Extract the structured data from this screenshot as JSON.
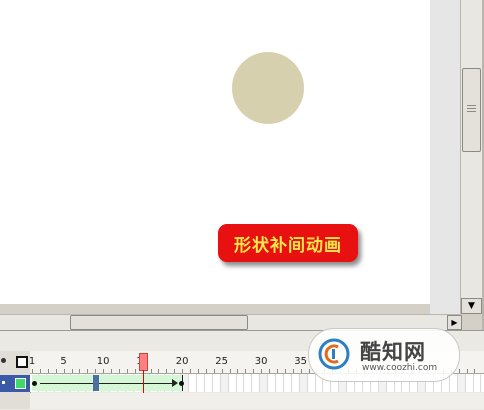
{
  "stage": {
    "tween_label": "形状补间动画",
    "circle_color": "#d6d0ae",
    "label_bg_color": "#e81010",
    "label_text_color": "#f5e84a"
  },
  "timeline": {
    "frame_numbers": [
      "1",
      "5",
      "10",
      "15",
      "20",
      "25",
      "30",
      "35"
    ],
    "current_frame": 15,
    "tween_start_frame": 1,
    "tween_end_frame": 20,
    "layer_color": "#3fd86a",
    "playhead_color": "#e00000"
  },
  "icons": {
    "eye": "eye-icon",
    "outline": "outline-square-icon",
    "scroll_down": "arrow-down-icon",
    "scroll_right": "arrow-right-icon"
  },
  "watermark": {
    "name": "酷知网",
    "url": "www.coozhi.com"
  }
}
